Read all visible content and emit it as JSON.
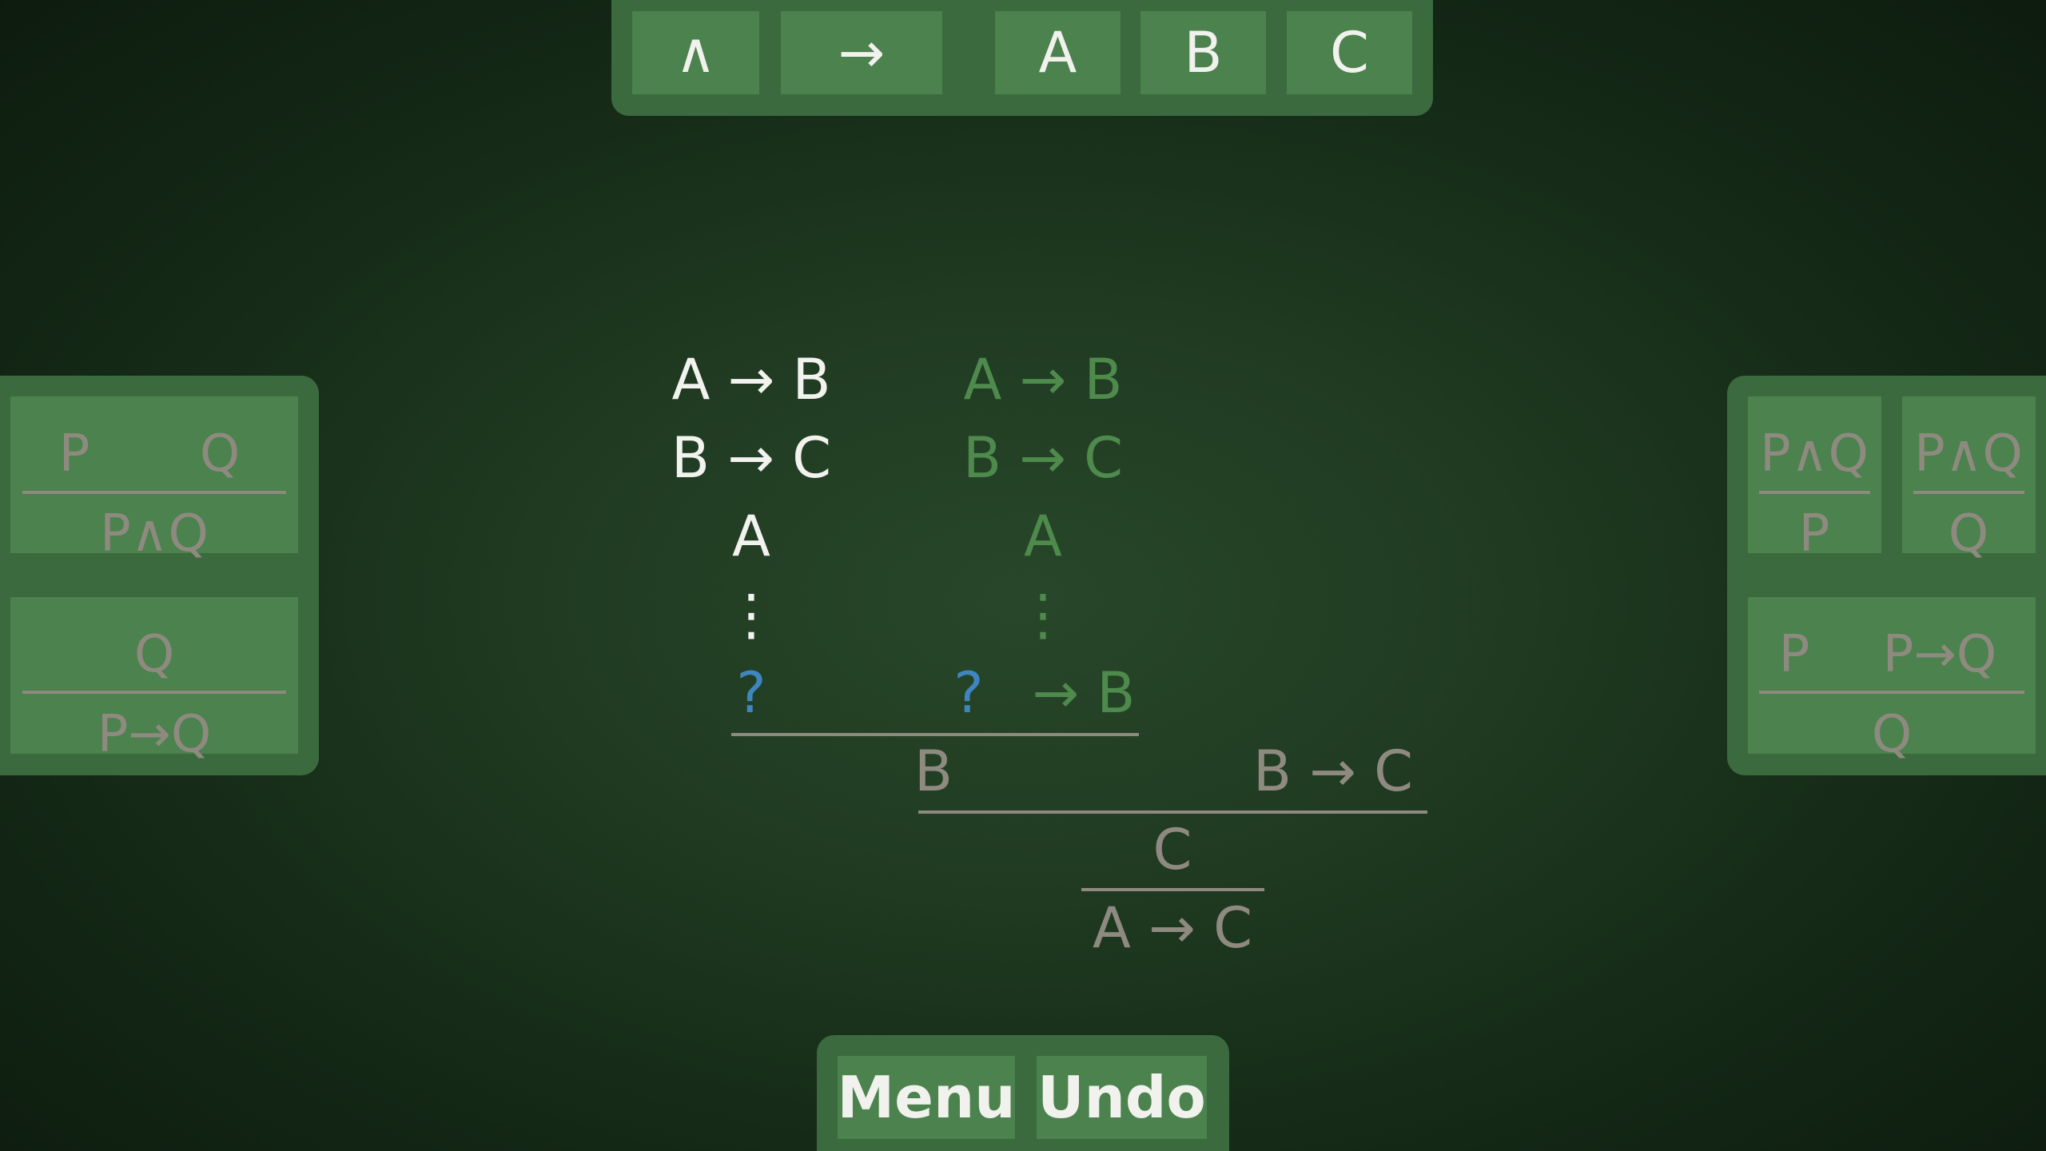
{
  "toolbar": {
    "buttons": [
      {
        "label": "∧"
      },
      {
        "label": "→"
      },
      {
        "label": "A"
      },
      {
        "label": "B"
      },
      {
        "label": "C"
      }
    ]
  },
  "left_rules": {
    "and_intro": {
      "premise_left": "P",
      "premise_right": "Q",
      "conclusion": "P∧Q"
    },
    "imp_intro": {
      "premise": "Q",
      "conclusion": "P→Q"
    }
  },
  "right_rules": {
    "and_elim_left": {
      "premise": "P∧Q",
      "conclusion": "P"
    },
    "and_elim_right": {
      "premise": "P∧Q",
      "conclusion": "Q"
    },
    "modus_ponens": {
      "premise_left": "P",
      "premise_right": "P→Q",
      "conclusion": "Q"
    }
  },
  "proof": {
    "hypotheses_white": [
      "A → B",
      "B → C"
    ],
    "assumption_white": "A",
    "dots_white": "⋮",
    "goal_white": "?",
    "hypotheses_green": [
      "A → B",
      "B → C"
    ],
    "assumption_green": "A",
    "dots_green": "⋮",
    "goal_green_hole": "?",
    "goal_green_rest": "→ B",
    "step1_left": "B",
    "step1_right": "B → C",
    "step2": "C",
    "step3": "A → C"
  },
  "bottom": {
    "menu_label": "Menu",
    "undo_label": "Undo"
  },
  "colors": {
    "background": "#1f3a21",
    "panel": "#3a6a3d",
    "tile": "#4b824d",
    "active_text": "#f2f2ee",
    "hint_text": "#4f8a4d",
    "derived_text": "#8f8a80",
    "hole": "#3f86c0"
  }
}
